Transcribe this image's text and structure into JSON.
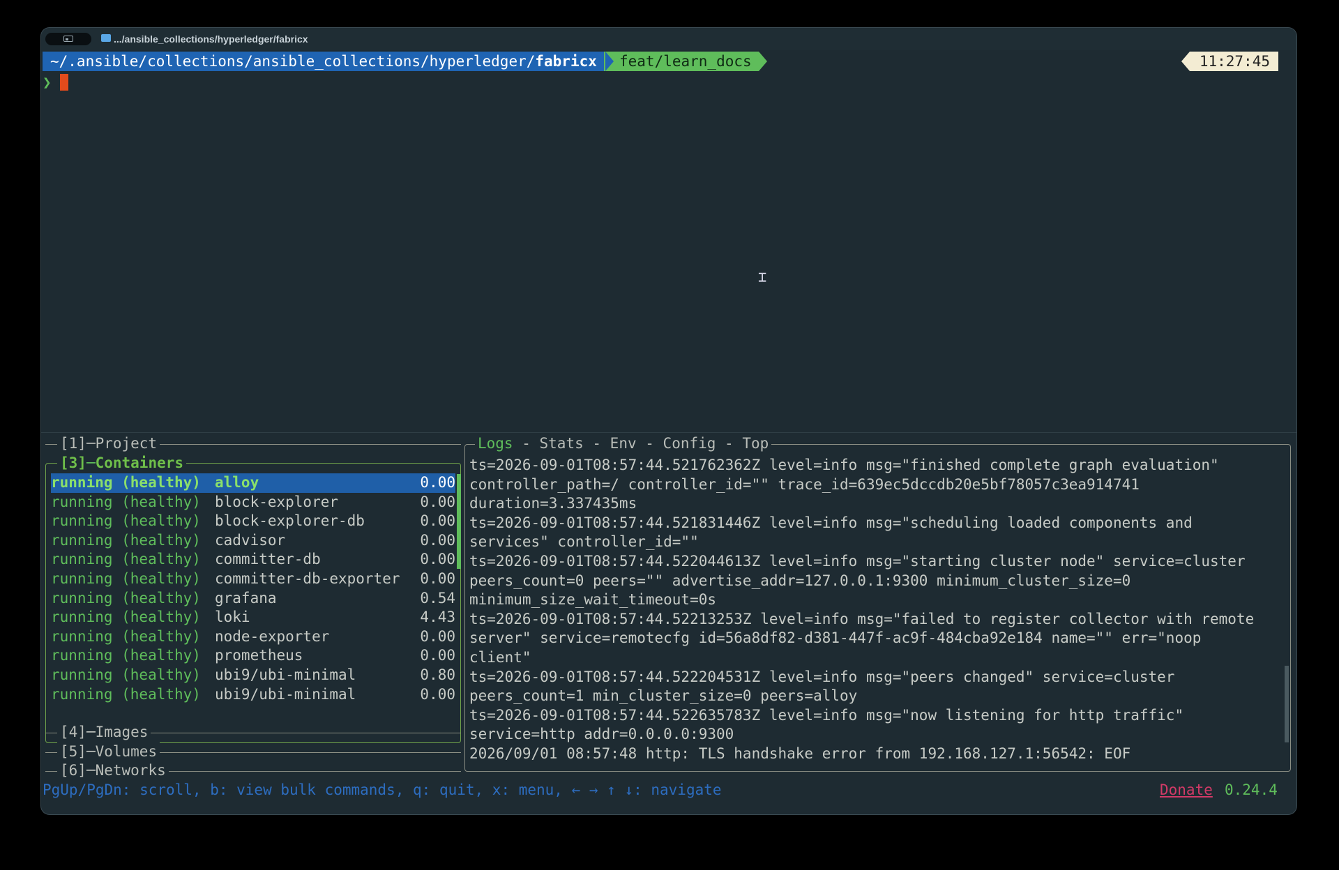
{
  "titlebar": {
    "path": ".../ansible_collections/hyperledger/fabricx"
  },
  "prompt": {
    "path_prefix": "~/.ansible/collections/ansible_collections/hyperledger/",
    "path_bold": "fabricx",
    "branch": "feat/learn_docs",
    "time": "11:27:45",
    "symbol": "❯"
  },
  "panels": {
    "project": "[1]",
    "project_label": "Project",
    "containers_num": "[3]",
    "containers_label": "Containers",
    "images": "[4]",
    "images_label": "Images",
    "volumes": "[5]",
    "volumes_label": "Volumes",
    "networks": "[6]",
    "networks_label": "Networks"
  },
  "containers": [
    {
      "status": "running (healthy)",
      "name": "alloy",
      "cpu": "0.00"
    },
    {
      "status": "running (healthy)",
      "name": "block-explorer",
      "cpu": "0.00"
    },
    {
      "status": "running (healthy)",
      "name": "block-explorer-db",
      "cpu": "0.00"
    },
    {
      "status": "running (healthy)",
      "name": "cadvisor",
      "cpu": "0.00"
    },
    {
      "status": "running (healthy)",
      "name": "committer-db",
      "cpu": "0.00"
    },
    {
      "status": "running (healthy)",
      "name": "committer-db-exporter",
      "cpu": "0.00"
    },
    {
      "status": "running (healthy)",
      "name": "grafana",
      "cpu": "0.54"
    },
    {
      "status": "running (healthy)",
      "name": "loki",
      "cpu": "4.43"
    },
    {
      "status": "running (healthy)",
      "name": "node-exporter",
      "cpu": "0.00"
    },
    {
      "status": "running (healthy)",
      "name": "prometheus",
      "cpu": "0.00"
    },
    {
      "status": "running (healthy)",
      "name": "ubi9/ubi-minimal",
      "cpu": "0.80"
    },
    {
      "status": "running (healthy)",
      "name": "ubi9/ubi-minimal",
      "cpu": "0.00"
    }
  ],
  "tabs": {
    "logs": "Logs",
    "sep": " - ",
    "stats": "Stats",
    "env": "Env",
    "config": "Config",
    "top": "Top"
  },
  "logs": [
    "ts=2026-09-01T08:57:44.521762362Z level=info msg=\"finished complete graph evaluation\"",
    "controller_path=/ controller_id=\"\" trace_id=639ec5dccdb20e5bf78057c3ea914741",
    "duration=3.337435ms",
    "ts=2026-09-01T08:57:44.521831446Z level=info msg=\"scheduling loaded components and",
    "services\" controller_id=\"\"",
    "ts=2026-09-01T08:57:44.522044613Z level=info msg=\"starting cluster node\" service=cluster",
    "peers_count=0 peers=\"\" advertise_addr=127.0.0.1:9300 minimum_cluster_size=0",
    "minimum_size_wait_timeout=0s",
    "ts=2026-09-01T08:57:44.52213253Z level=info msg=\"failed to register collector with remote",
    "server\" service=remotecfg id=56a8df82-d381-447f-ac9f-484cba92e184 name=\"\" err=\"noop",
    "client\"",
    "ts=2026-09-01T08:57:44.522204531Z level=info msg=\"peers changed\" service=cluster",
    "peers_count=1 min_cluster_size=0 peers=alloy",
    "ts=2026-09-01T08:57:44.522635783Z level=info msg=\"now listening for http traffic\"",
    "service=http addr=0.0.0.0:9300",
    "2026/09/01 08:57:48 http: TLS handshake error from 192.168.127.1:56542: EOF"
  ],
  "footer": {
    "help": "PgUp/PgDn: scroll, b: view bulk commands, q: quit, x: menu, ← → ↑ ↓: navigate",
    "donate": "Donate",
    "version": "0.24.4"
  }
}
